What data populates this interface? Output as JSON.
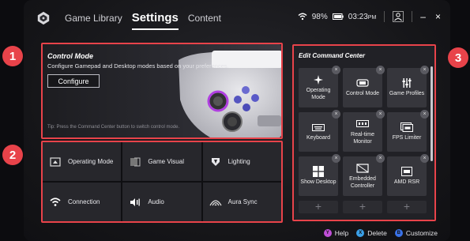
{
  "header": {
    "tabs": [
      {
        "label": "Game Library",
        "active": false
      },
      {
        "label": "Settings",
        "active": true
      },
      {
        "label": "Content",
        "active": false
      }
    ],
    "status": {
      "wifi_icon": "wifi-icon",
      "battery_percent": "98%",
      "battery_icon": "battery-icon",
      "time": "03:23",
      "time_suffix": "PM",
      "profile_icon": "profile-icon",
      "minimize_label": "–",
      "close_label": "×"
    }
  },
  "callouts": [
    "1",
    "2",
    "3"
  ],
  "control_mode": {
    "title": "Control Mode",
    "description": "Configure Gamepad and Desktop modes based on your preferences.",
    "configure_label": "Configure",
    "tip": "Tip: Press the Command Center button to switch control mode."
  },
  "settings_grid": [
    {
      "label": "Operating Mode",
      "icon": "operating-mode-icon"
    },
    {
      "label": "Game Visual",
      "icon": "game-visual-icon"
    },
    {
      "label": "Lighting",
      "icon": "lighting-icon"
    },
    {
      "label": "Connection",
      "icon": "wifi-icon"
    },
    {
      "label": "Audio",
      "icon": "audio-icon"
    },
    {
      "label": "Aura Sync",
      "icon": "aura-sync-icon"
    }
  ],
  "command_center": {
    "title": "Edit Command Center",
    "tiles": [
      {
        "label": "Operating Mode",
        "icon": "fan-icon"
      },
      {
        "label": "Control Mode",
        "icon": "gamepad-icon"
      },
      {
        "label": "Game Profiles",
        "icon": "sliders-icon"
      },
      {
        "label": "Keyboard",
        "icon": "keyboard-icon"
      },
      {
        "label": "Real-time Monitor",
        "icon": "monitor-icon"
      },
      {
        "label": "FPS Limiter",
        "icon": "fps-icon"
      },
      {
        "label": "Show Desktop",
        "icon": "windows-icon"
      },
      {
        "label": "Embedded Controller",
        "icon": "controller-icon"
      },
      {
        "label": "AMD RSR",
        "icon": "rsr-icon"
      }
    ],
    "remove_label": "×",
    "add_label": "+"
  },
  "footer": {
    "hints": [
      {
        "button": "Y",
        "label": "Help",
        "color": "#c04fd8"
      },
      {
        "button": "X",
        "label": "Delete",
        "color": "#3aa0e8"
      },
      {
        "button": "B",
        "label": "Customize",
        "color": "#3a72e8"
      }
    ]
  },
  "colors": {
    "accent": "#e8434a",
    "background": "#151518"
  }
}
